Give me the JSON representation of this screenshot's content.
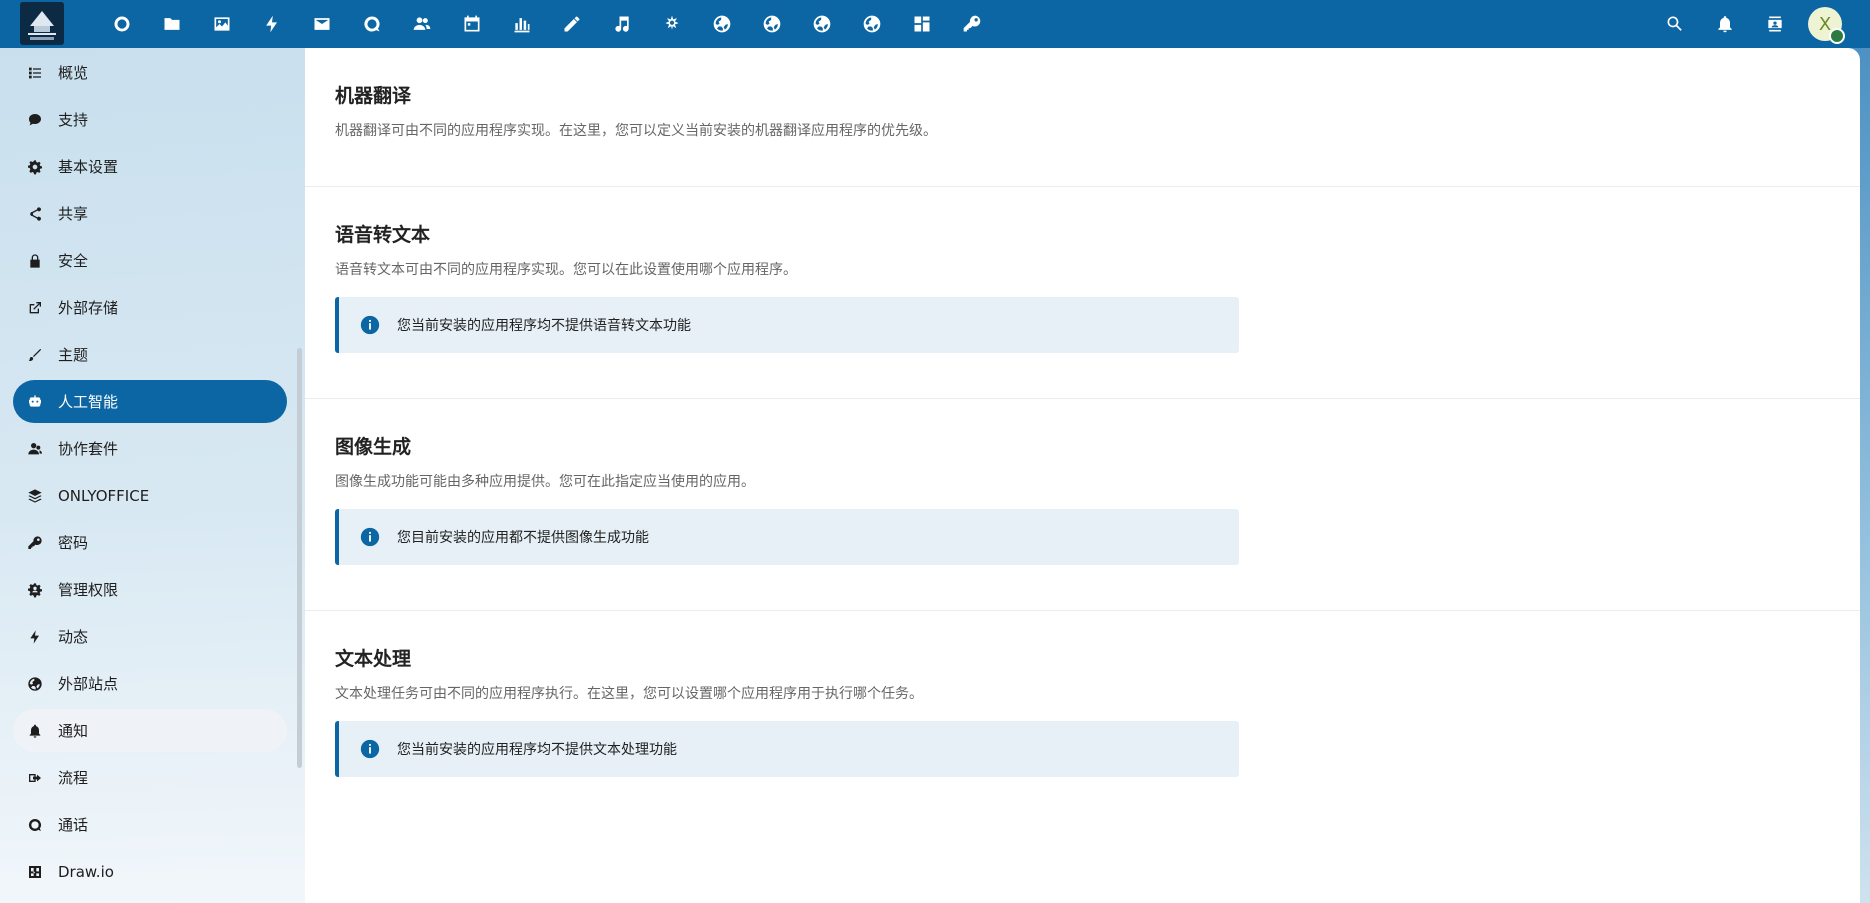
{
  "header": {
    "logo_name": "nextcloud-instance-logo",
    "apps": [
      {
        "icon": "dashboard-icon",
        "label": "Dashboard"
      },
      {
        "icon": "folder-icon",
        "label": "Files"
      },
      {
        "icon": "image-icon",
        "label": "Photos"
      },
      {
        "icon": "lightning-icon",
        "label": "Activity"
      },
      {
        "icon": "mail-icon",
        "label": "Mail"
      },
      {
        "icon": "talk-icon",
        "label": "Talk"
      },
      {
        "icon": "contacts-icon",
        "label": "Contacts"
      },
      {
        "icon": "calendar-icon",
        "label": "Calendar"
      },
      {
        "icon": "chart-icon",
        "label": "Analytics"
      },
      {
        "icon": "pencil-icon",
        "label": "Notes"
      },
      {
        "icon": "music-icon",
        "label": "Music"
      },
      {
        "icon": "star-person-icon",
        "label": "App"
      },
      {
        "icon": "globe-icon",
        "label": "External site 1"
      },
      {
        "icon": "globe-icon",
        "label": "External site 2"
      },
      {
        "icon": "globe-icon",
        "label": "External site 3"
      },
      {
        "icon": "globe-icon",
        "label": "External site 4"
      },
      {
        "icon": "deck-icon",
        "label": "Deck"
      },
      {
        "icon": "key-icon",
        "label": "Passwords"
      }
    ],
    "right_icons": [
      "search-icon",
      "bell-icon",
      "contacts-menu-icon"
    ],
    "avatar_letter": "X"
  },
  "sidebar": {
    "items": [
      {
        "label": "概览",
        "icon": "list-icon"
      },
      {
        "label": "支持",
        "icon": "chat-bubble-icon"
      },
      {
        "label": "基本设置",
        "icon": "gear-icon"
      },
      {
        "label": "共享",
        "icon": "share-icon"
      },
      {
        "label": "安全",
        "icon": "lock-icon"
      },
      {
        "label": "外部存储",
        "icon": "external-link-icon"
      },
      {
        "label": "主题",
        "icon": "paintbrush-icon"
      },
      {
        "label": "人工智能",
        "icon": "robot-icon",
        "active": true
      },
      {
        "label": "协作套件",
        "icon": "people-icon"
      },
      {
        "label": "ONLYOFFICE",
        "icon": "layers-icon"
      },
      {
        "label": "密码",
        "icon": "key-icon"
      },
      {
        "label": "管理权限",
        "icon": "admin-gear-icon"
      },
      {
        "label": "动态",
        "icon": "lightning-icon"
      },
      {
        "label": "外部站点",
        "icon": "globe-icon"
      },
      {
        "label": "通知",
        "icon": "bell-icon",
        "hover": true
      },
      {
        "label": "流程",
        "icon": "flow-icon"
      },
      {
        "label": "通话",
        "icon": "talk-icon"
      },
      {
        "label": "Draw.io",
        "icon": "drawio-icon"
      }
    ]
  },
  "main": {
    "sections": [
      {
        "title": "机器翻译",
        "description": "机器翻译可由不同的应用程序实现。在这里，您可以定义当前安装的机器翻译应用程序的优先级。",
        "notice": ""
      },
      {
        "title": "语音转文本",
        "description": "语音转文本可由不同的应用程序实现。您可以在此设置使用哪个应用程序。",
        "notice": "您当前安装的应用程序均不提供语音转文本功能"
      },
      {
        "title": "图像生成",
        "description": "图像生成功能可能由多种应用提供。您可在此指定应当使用的应用。",
        "notice": "您目前安装的应用都不提供图像生成功能"
      },
      {
        "title": "文本处理",
        "description": "文本处理任务可由不同的应用程序执行。在这里，您可以设置哪个应用程序用于执行哪个任务。",
        "notice": "您当前安装的应用程序均不提供文本处理功能"
      }
    ]
  },
  "colors": {
    "primary": "#0b66a3",
    "notice_bg": "#e6f0f6",
    "status_online": "#2d7b41"
  }
}
